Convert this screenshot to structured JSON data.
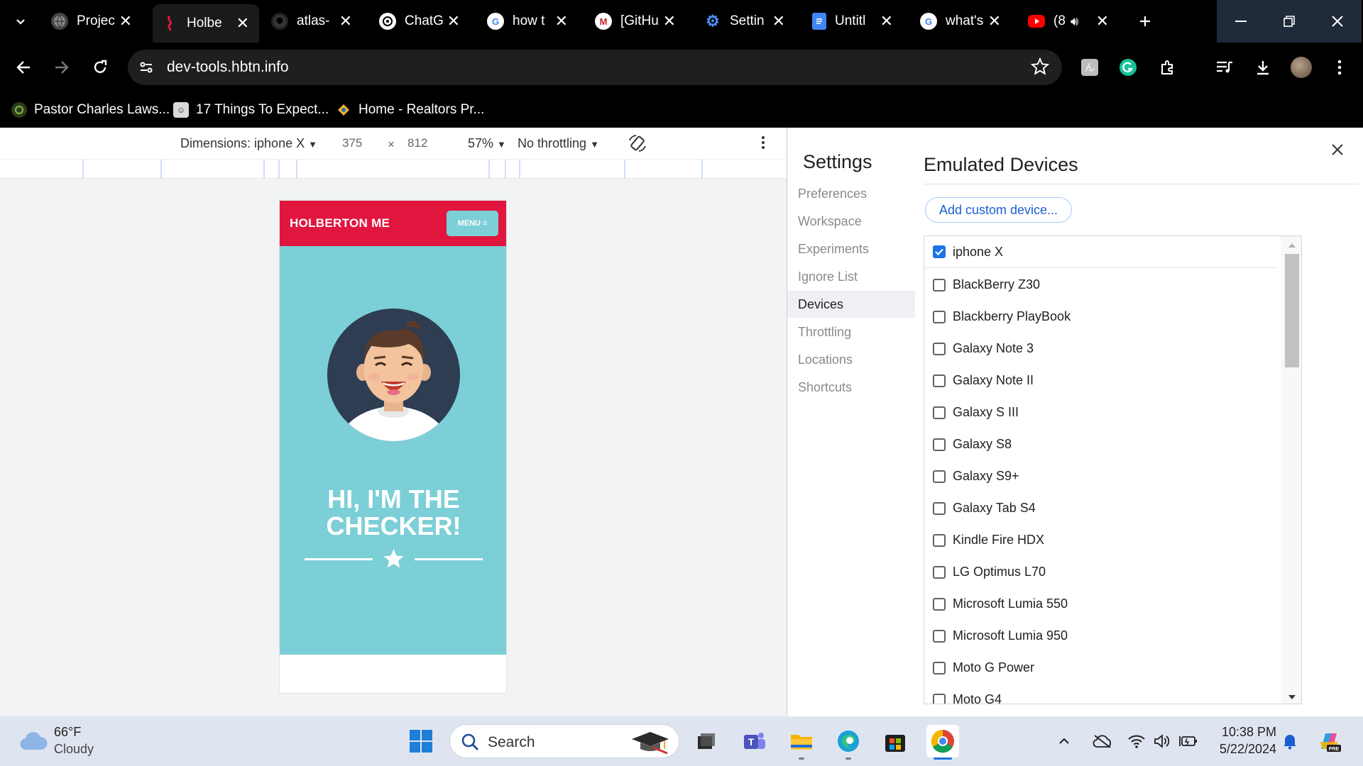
{
  "tabs": [
    {
      "title": "Projec",
      "favicon": "globe-icon",
      "active": false
    },
    {
      "title": "Holbe",
      "favicon": "holberton-icon",
      "active": true
    },
    {
      "title": "atlas-",
      "favicon": "github-icon",
      "active": false
    },
    {
      "title": "ChatG",
      "favicon": "chatgpt-icon",
      "active": false
    },
    {
      "title": "how t",
      "favicon": "google-icon",
      "active": false
    },
    {
      "title": "[GitHu",
      "favicon": "gmail-icon",
      "active": false
    },
    {
      "title": "Settin",
      "favicon": "gear-icon",
      "active": false
    },
    {
      "title": "Untitl",
      "favicon": "docs-icon",
      "active": false
    },
    {
      "title": "what's",
      "favicon": "google-icon",
      "active": false
    },
    {
      "title": "(8",
      "favicon": "youtube-icon",
      "active": false
    }
  ],
  "toolbar": {
    "url": "dev-tools.hbtn.info"
  },
  "bookmarks": [
    {
      "label": "Pastor Charles Laws..."
    },
    {
      "label": "17 Things To Expect..."
    },
    {
      "label": "Home - Realtors Pr..."
    }
  ],
  "device_toolbar": {
    "dimensions_label": "Dimensions: iphone X",
    "width": "375",
    "times": "×",
    "height": "812",
    "zoom": "57%",
    "throttling": "No throttling"
  },
  "page": {
    "brand": "HOLBERTON ME",
    "menu_label": "MENU ≡",
    "title_line1": "HI, I'M THE",
    "title_line2": "CHECKER!"
  },
  "settings": {
    "title": "Settings",
    "nav": [
      {
        "label": "Preferences",
        "active": false
      },
      {
        "label": "Workspace",
        "active": false
      },
      {
        "label": "Experiments",
        "active": false
      },
      {
        "label": "Ignore List",
        "active": false
      },
      {
        "label": "Devices",
        "active": true
      },
      {
        "label": "Throttling",
        "active": false
      },
      {
        "label": "Locations",
        "active": false
      },
      {
        "label": "Shortcuts",
        "active": false
      }
    ],
    "section_title": "Emulated Devices",
    "add_button": "Add custom device...",
    "devices": [
      {
        "name": "iphone X",
        "checked": true
      },
      {
        "name": "BlackBerry Z30",
        "checked": false
      },
      {
        "name": "Blackberry PlayBook",
        "checked": false
      },
      {
        "name": "Galaxy Note 3",
        "checked": false
      },
      {
        "name": "Galaxy Note II",
        "checked": false
      },
      {
        "name": "Galaxy S III",
        "checked": false
      },
      {
        "name": "Galaxy S8",
        "checked": false
      },
      {
        "name": "Galaxy S9+",
        "checked": false
      },
      {
        "name": "Galaxy Tab S4",
        "checked": false
      },
      {
        "name": "Kindle Fire HDX",
        "checked": false
      },
      {
        "name": "LG Optimus L70",
        "checked": false
      },
      {
        "name": "Microsoft Lumia 550",
        "checked": false
      },
      {
        "name": "Microsoft Lumia 950",
        "checked": false
      },
      {
        "name": "Moto G Power",
        "checked": false
      },
      {
        "name": "Moto G4",
        "checked": false
      }
    ]
  },
  "taskbar": {
    "weather_temp": "66°F",
    "weather_desc": "Cloudy",
    "search_label": "Search",
    "time": "10:38 PM",
    "date": "5/22/2024"
  },
  "colors": {
    "holberton_red": "#e0163f",
    "hero_teal": "#7ccfd6",
    "accent_blue": "#1a73e8"
  }
}
